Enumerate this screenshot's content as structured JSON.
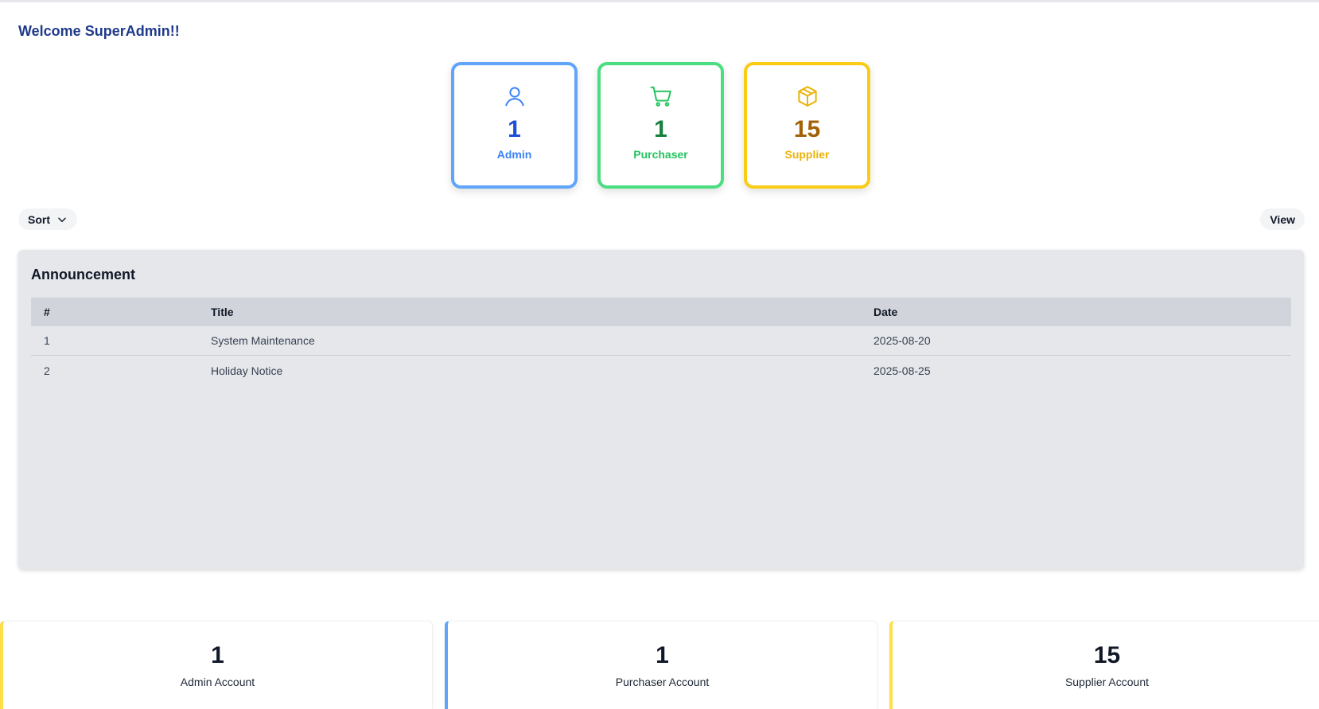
{
  "header": {
    "welcome": "Welcome SuperAdmin!!"
  },
  "stat_cards": [
    {
      "icon": "user-icon",
      "value": "1",
      "label": "Admin",
      "color": "#60a5fa"
    },
    {
      "icon": "cart-icon",
      "value": "1",
      "label": "Purchaser",
      "color": "#4ade80"
    },
    {
      "icon": "box-icon",
      "value": "15",
      "label": "Supplier",
      "color": "#facc15"
    }
  ],
  "toolbar": {
    "sort_label": "Sort",
    "view_label": "View"
  },
  "announcement": {
    "title": "Announcement",
    "columns": [
      "#",
      "Title",
      "Date"
    ],
    "rows": [
      [
        "1",
        "System Maintenance",
        "2025-08-20"
      ],
      [
        "2",
        "Holiday Notice",
        "2025-08-25"
      ]
    ]
  },
  "account_cards": [
    {
      "value": "1",
      "label": "Admin Account",
      "accent": "#fde047"
    },
    {
      "value": "1",
      "label": "Purchaser Account",
      "accent": "#60a5fa"
    },
    {
      "value": "15",
      "label": "Supplier Account",
      "accent": "#fde047"
    }
  ]
}
